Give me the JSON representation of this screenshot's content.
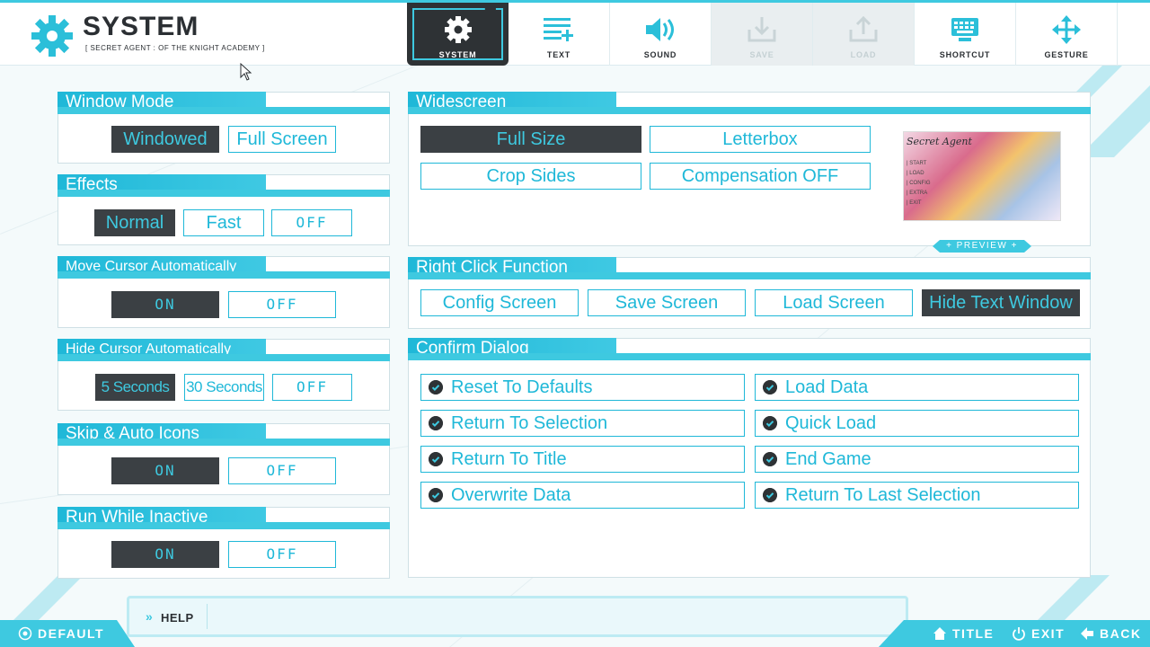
{
  "header": {
    "title": "SYSTEM",
    "subtitle": "[ SECRET AGENT : OF THE KNIGHT ACADEMY ]",
    "tabs": [
      {
        "label": "SYSTEM",
        "icon": "gear-icon",
        "state": "active"
      },
      {
        "label": "TEXT",
        "icon": "text-icon",
        "state": "normal"
      },
      {
        "label": "SOUND",
        "icon": "speaker-icon",
        "state": "normal"
      },
      {
        "label": "SAVE",
        "icon": "download-icon",
        "state": "disabled"
      },
      {
        "label": "LOAD",
        "icon": "upload-icon",
        "state": "disabled"
      },
      {
        "label": "SHORTCUT",
        "icon": "keyboard-icon",
        "state": "normal"
      },
      {
        "label": "GESTURE",
        "icon": "move-arrows-icon",
        "state": "normal"
      }
    ]
  },
  "window_mode": {
    "title": "Window Mode",
    "options": [
      "Windowed",
      "Full Screen"
    ],
    "selected": "Windowed"
  },
  "effects": {
    "title": "Effects",
    "options": [
      "Normal",
      "Fast",
      "OFF"
    ],
    "selected": "Normal"
  },
  "move_cursor": {
    "title": "Move Cursor Automatically",
    "options": [
      "ON",
      "OFF"
    ],
    "selected": "ON"
  },
  "hide_cursor": {
    "title": "Hide Cursor Automatically",
    "options": [
      "5 Seconds",
      "30 Seconds",
      "OFF"
    ],
    "selected": "5 Seconds"
  },
  "skip_auto": {
    "title": "Skip & Auto Icons",
    "options": [
      "ON",
      "OFF"
    ],
    "selected": "ON"
  },
  "run_inactive": {
    "title": "Run While Inactive",
    "options": [
      "ON",
      "OFF"
    ],
    "selected": "ON"
  },
  "widescreen": {
    "title": "Widescreen",
    "options": [
      "Full Size",
      "Letterbox",
      "Crop Sides",
      "Compensation OFF"
    ],
    "selected": "Full Size",
    "preview_label": "+ PREVIEW +",
    "preview_logo": "Secret Agent",
    "preview_menu": [
      "| START",
      "| LOAD",
      "| CONFIG",
      "| EXTRA",
      "| EXIT"
    ]
  },
  "right_click": {
    "title": "Right Click Function",
    "options": [
      "Config Screen",
      "Save Screen",
      "Load Screen",
      "Hide Text Window"
    ],
    "selected": "Hide Text Window"
  },
  "confirm_dialog": {
    "title": "Confirm Dialog",
    "left": [
      "Reset To Defaults",
      "Return To Selection",
      "Return To Title",
      "Overwrite Data"
    ],
    "right": [
      "Load Data",
      "Quick Load",
      "End Game",
      "Return To Last Selection"
    ]
  },
  "footer": {
    "help_label": "HELP",
    "help_text": "",
    "default_label": "DEFAULT",
    "title_label": "TITLE",
    "exit_label": "EXIT",
    "back_label": "BACK"
  },
  "colors": {
    "accent": "#3ec9e0",
    "accent_dark": "#1fb8d8",
    "selected_bg": "#3b4044",
    "text_dark": "#2b2f33"
  }
}
